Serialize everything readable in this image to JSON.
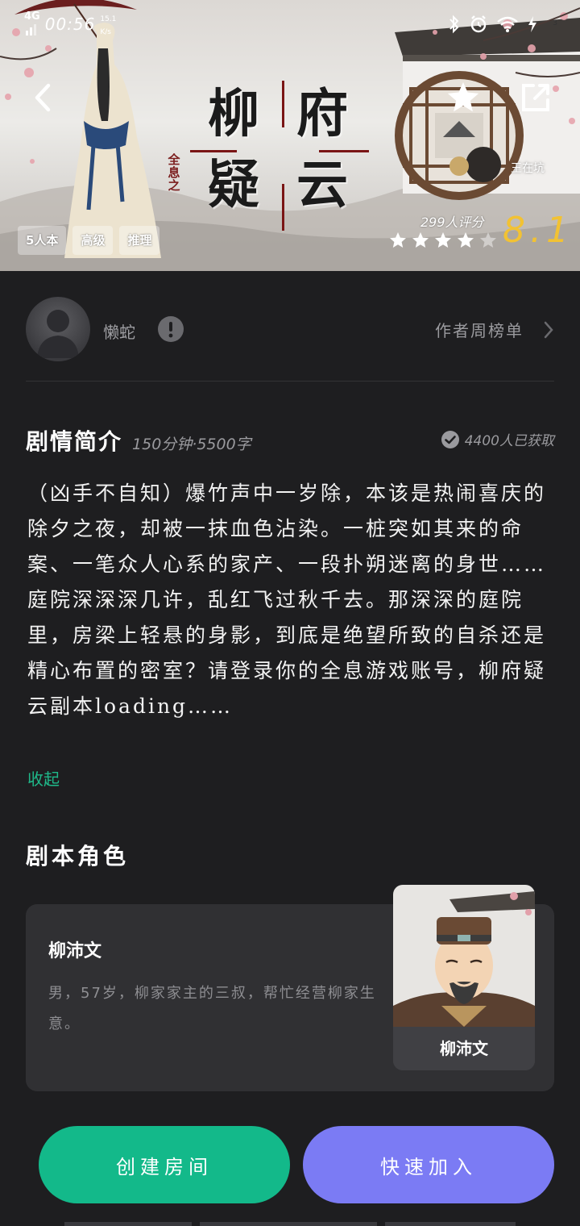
{
  "status_bar": {
    "network": "4G",
    "time": "00:56",
    "tiny_left": "15.1",
    "tiny_left2": "K/s",
    "battery_text": "3"
  },
  "hero": {
    "title_chars": [
      "柳",
      "府",
      "疑",
      "云"
    ],
    "title_prefix": "全息之",
    "author_tag": "王在坑",
    "tags": [
      "5人本",
      "高级",
      "推理"
    ],
    "rating_count": "299人评分",
    "rating_score": "8.1",
    "rating_stars_filled": 4,
    "rating_stars_total": 5
  },
  "author": {
    "name": "懒蛇",
    "rank_label": "作者周榜单"
  },
  "synopsis": {
    "title": "剧情简介",
    "meta": "150分钟·5500字",
    "acquired": "4400人已获取",
    "body": "（凶手不自知）爆竹声中一岁除，本该是热闹喜庆的除夕之夜，却被一抹血色沾染。一桩突如其来的命案、一笔众人心系的家产、一段扑朔迷离的身世……庭院深深深几许，乱红飞过秋千去。那深深的庭院里，房梁上轻悬的身影，到底是绝望所致的自杀还是精心布置的密室？请登录你的全息游戏账号，柳府疑云副本loading……",
    "collapse_label": "收起"
  },
  "roles": {
    "title": "剧本角色",
    "items": [
      {
        "name": "柳沛文",
        "desc": "男，57岁，柳家家主的三叔，帮忙经营柳家生意。",
        "portrait_name": "柳沛文"
      }
    ]
  },
  "actions": {
    "create_label": "创建房间",
    "join_label": "快速加入"
  },
  "colors": {
    "background": "#1e1e20",
    "create_button": "#13b98a",
    "join_button": "#7b7bf4",
    "collapse_link": "#1fb98a",
    "rating_score": "#f2c233"
  }
}
